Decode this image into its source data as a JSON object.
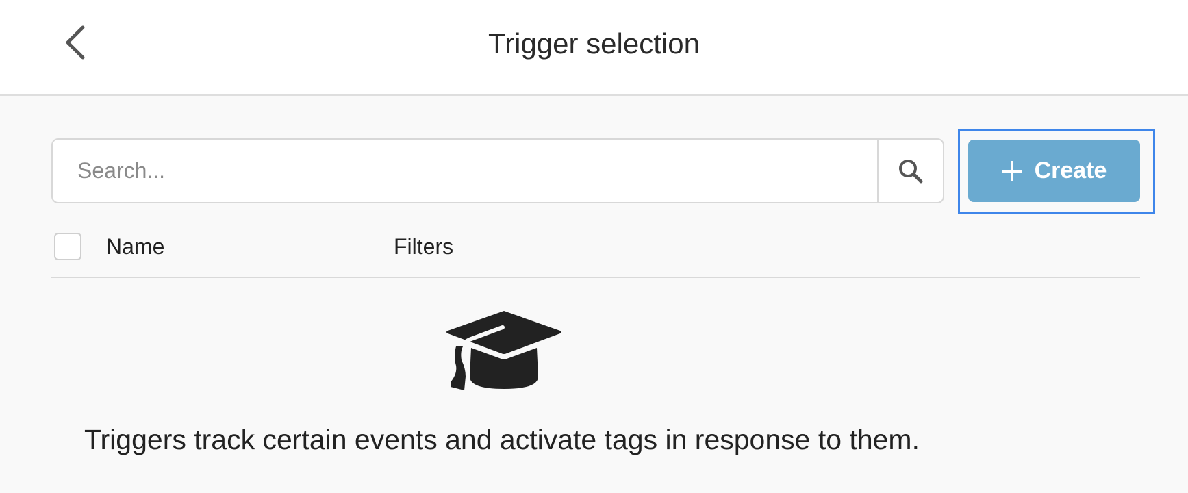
{
  "header": {
    "title": "Trigger selection",
    "back_icon": "chevron-left-icon"
  },
  "toolbar": {
    "search_placeholder": "Search...",
    "search_value": "",
    "search_icon": "search-icon",
    "create_label": "Create",
    "create_icon": "plus-icon",
    "accent_color": "#6aaad0",
    "focus_color": "#3f86ea"
  },
  "table": {
    "columns": [
      "Name",
      "Filters"
    ],
    "select_all_checked": false
  },
  "empty_state": {
    "icon": "graduation-cap-icon",
    "message": "Triggers track certain events and activate tags in response to them."
  }
}
